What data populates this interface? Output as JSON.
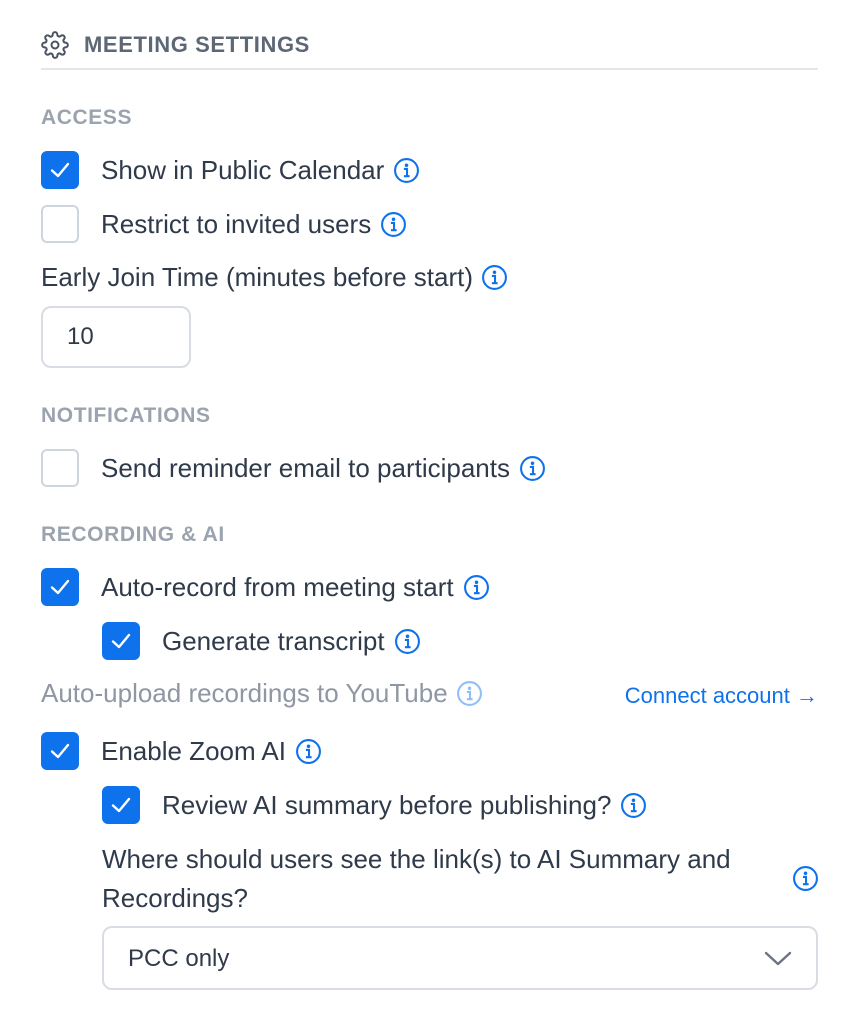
{
  "header": {
    "title": "MEETING SETTINGS",
    "icon": "gear-icon"
  },
  "sections": {
    "access": "ACCESS",
    "notifications": "NOTIFICATIONS",
    "recording": "RECORDING & AI"
  },
  "access": {
    "public_calendar": {
      "label": "Show in Public Calendar",
      "checked": true
    },
    "restrict_invited": {
      "label": "Restrict to invited users",
      "checked": false
    },
    "early_join": {
      "label": "Early Join Time (minutes before start)",
      "value": "10"
    }
  },
  "notifications": {
    "reminder_email": {
      "label": "Send reminder email to participants",
      "checked": false
    }
  },
  "recording": {
    "auto_record": {
      "label": "Auto-record from meeting start",
      "checked": true
    },
    "transcript": {
      "label": "Generate transcript",
      "checked": true
    },
    "youtube": {
      "label": "Auto-upload recordings to YouTube",
      "link": "Connect account →"
    },
    "zoom_ai": {
      "label": "Enable Zoom AI",
      "checked": true
    },
    "review_summary": {
      "label": "Review AI summary before publishing?",
      "checked": true
    },
    "link_location": {
      "question": "Where should users see the link(s) to AI Summary and Recordings?",
      "selected": "PCC only"
    }
  },
  "colors": {
    "accent": "#0e72ed",
    "text": "#2f3a4a",
    "muted": "#9aa3ae",
    "border": "#d8dde3"
  }
}
